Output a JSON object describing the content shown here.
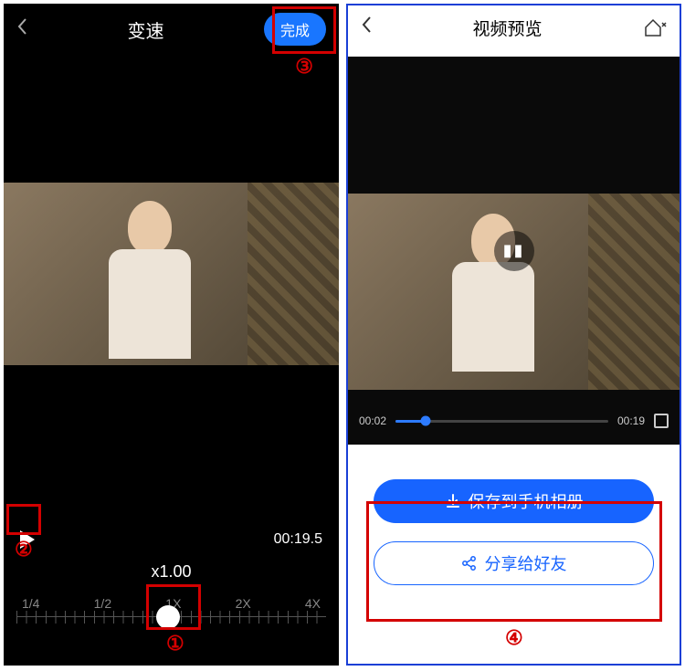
{
  "left": {
    "title": "变速",
    "done_label": "完成",
    "duration": "00:19.5",
    "speed_value": "x1.00",
    "speed_marks": [
      "1/4",
      "1/2",
      "1X",
      "2X",
      "4X"
    ]
  },
  "right": {
    "title": "视频预览",
    "current_time": "00:02",
    "total_time": "00:19",
    "save_label": "保存到手机相册",
    "share_label": "分享给好友"
  },
  "annotations": {
    "n1": "①",
    "n2": "②",
    "n3": "③",
    "n4": "④"
  }
}
